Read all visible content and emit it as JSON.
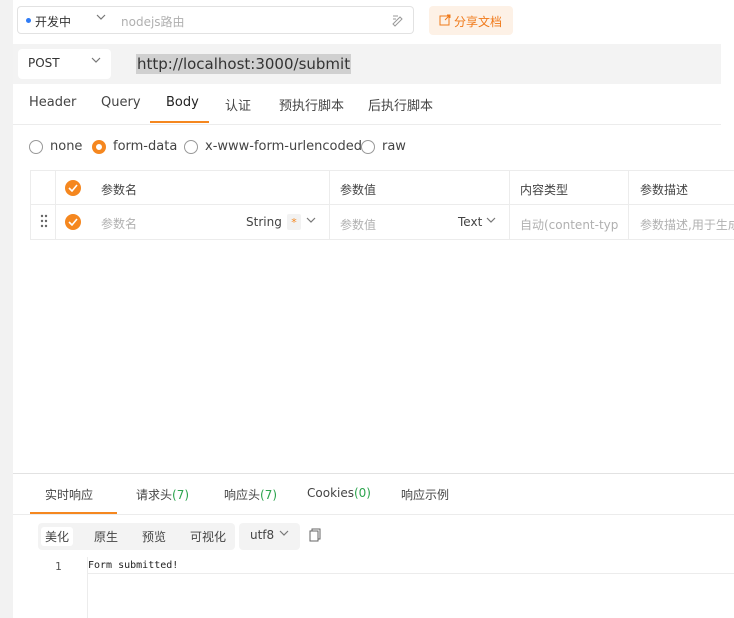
{
  "top_bar": {
    "env_label": "开发中",
    "name_placeholder": "nodejs路由",
    "share_label": "分享文档"
  },
  "url_bar": {
    "method": "POST",
    "url": "http://localhost:3000/submit"
  },
  "request_tabs": [
    "Header",
    "Query",
    "Body",
    "认证",
    "预执行脚本",
    "后执行脚本"
  ],
  "active_request_tab": "Body",
  "body_types": [
    {
      "label": "none",
      "selected": false
    },
    {
      "label": "form-data",
      "selected": true
    },
    {
      "label": "x-www-form-urlencoded",
      "selected": false
    },
    {
      "label": "raw",
      "selected": false
    }
  ],
  "table": {
    "headers": [
      "参数名",
      "参数值",
      "内容类型",
      "参数描述"
    ],
    "row": {
      "name_placeholder": "参数名",
      "name_type": "String",
      "required_mark": "*",
      "value_placeholder": "参数值",
      "value_type": "Text",
      "content_type_placeholder": "自动(content-typ",
      "description_placeholder": "参数描述,用于生成"
    }
  },
  "response": {
    "tabs": [
      {
        "label": "实时响应",
        "count": ""
      },
      {
        "label": "请求头",
        "count": "(7)"
      },
      {
        "label": "响应头",
        "count": "(7)"
      },
      {
        "label": "Cookies",
        "count": "(0)"
      },
      {
        "label": "响应示例",
        "count": ""
      }
    ],
    "view_options": [
      "美化",
      "原生",
      "预览",
      "可视化"
    ],
    "active_view": "美化",
    "encoding": "utf8",
    "lines": [
      {
        "no": "1",
        "text": "Form submitted!"
      }
    ]
  },
  "colors": {
    "accent": "#f5871f",
    "count_green": "#2da44e",
    "env_dot": "#2f7cf6"
  },
  "icons": [
    "chevron-down-icon",
    "edit-icon",
    "share-icon",
    "check-icon",
    "drag-handle-icon",
    "copy-icon"
  ]
}
